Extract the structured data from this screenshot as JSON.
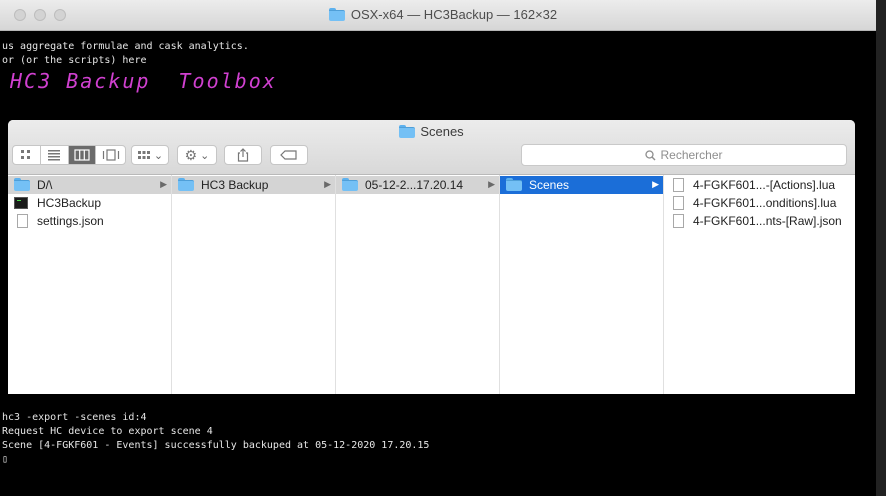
{
  "terminal": {
    "title": "OSX-x64 — HC3Backup — 162×32",
    "top_lines": [
      "us aggregate formulae and cask analytics.",
      "or (or the scripts) here"
    ],
    "banner_text": "HC3 Backup  Toolbox",
    "bottom_lines": [
      "hc3 -export -scenes id:4",
      "Request HC device to export scene 4",
      "Scene [4-FGKF601 - Events] successfully backuped at 05-12-2020 17.20.15",
      "▯"
    ]
  },
  "finder": {
    "title": "Scenes",
    "search_placeholder": "Rechercher",
    "toolbar": {
      "view_icons": "icon-view-icon",
      "view_list": "list-view-icon",
      "view_columns": "column-view-icon",
      "view_gallery": "gallery-view-icon",
      "group_icon": "group-icon",
      "action_icon": "gear-icon",
      "share_icon": "share-icon",
      "tag_icon": "tag-icon"
    },
    "columns": [
      {
        "items": [
          {
            "label": "D/\\",
            "icon": "folder",
            "state": "selected-inactive",
            "chevron": true
          },
          {
            "label": "HC3Backup",
            "icon": "executable",
            "state": "",
            "chevron": false
          },
          {
            "label": "settings.json",
            "icon": "document",
            "state": "",
            "chevron": false
          }
        ]
      },
      {
        "items": [
          {
            "label": "HC3 Backup",
            "icon": "folder",
            "state": "selected-inactive",
            "chevron": true
          }
        ]
      },
      {
        "items": [
          {
            "label": "05-12-2...17.20.14",
            "icon": "folder",
            "state": "selected-inactive",
            "chevron": true
          }
        ]
      },
      {
        "items": [
          {
            "label": "Scenes",
            "icon": "folder",
            "state": "selected-active",
            "chevron": true
          }
        ]
      },
      {
        "items": [
          {
            "label": "4-FGKF601...-[Actions].lua",
            "icon": "document",
            "state": "",
            "chevron": false
          },
          {
            "label": "4-FGKF601...onditions].lua",
            "icon": "document",
            "state": "",
            "chevron": false
          },
          {
            "label": "4-FGKF601...nts-[Raw].json",
            "icon": "document",
            "state": "",
            "chevron": false
          }
        ]
      }
    ]
  },
  "colors": {
    "selection_blue": "#1b6ed8",
    "selection_grey": "#d4d4d4",
    "banner_magenta": "#d040d0"
  }
}
